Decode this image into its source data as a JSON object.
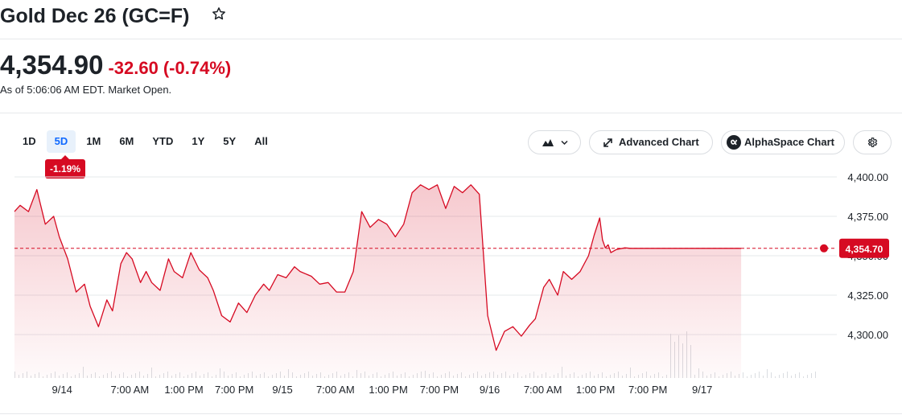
{
  "header": {
    "title": "Gold Dec 26 (GC=F)",
    "price": "4,354.90",
    "change": "-32.60",
    "change_pct": "(-0.74%)",
    "as_of": "As of 5:06:06 AM EDT. Market Open."
  },
  "toolbar": {
    "ranges": [
      "1D",
      "5D",
      "1M",
      "6M",
      "YTD",
      "1Y",
      "5Y",
      "All"
    ],
    "active_range": "5D",
    "period_change": "-1.19%",
    "advanced_chart": "Advanced Chart",
    "alphaspace_chart": "AlphaSpace Chart"
  },
  "colors": {
    "down": "#d60a22",
    "active_tab": "#0f69ff",
    "text": "#1d2228",
    "grid": "#e6e8eb"
  },
  "chart_data": {
    "type": "area",
    "ylim": [
      4280,
      4405
    ],
    "yticks": [
      4300,
      4325,
      4350,
      4375,
      4400
    ],
    "ytick_labels": [
      "4,300.00",
      "4,325.00",
      "4,350.00",
      "4,375.00",
      "4,400.00"
    ],
    "last_price": 4354.7,
    "last_price_label": "4,354.70",
    "x_labels": [
      {
        "label": "9/14",
        "pos": 0.17
      },
      {
        "label": "7:00 AM",
        "pos": 0.412
      },
      {
        "label": "1:00 PM",
        "pos": 0.605
      },
      {
        "label": "7:00 PM",
        "pos": 0.785
      },
      {
        "label": "9/15",
        "pos": 0.957
      },
      {
        "label": "7:00 AM",
        "pos": 1.146
      },
      {
        "label": "1:00 PM",
        "pos": 1.335
      },
      {
        "label": "7:00 PM",
        "pos": 1.517
      },
      {
        "label": "9/16",
        "pos": 1.697
      },
      {
        "label": "7:00 AM",
        "pos": 1.887
      },
      {
        "label": "1:00 PM",
        "pos": 2.075
      },
      {
        "label": "7:00 PM",
        "pos": 2.262
      },
      {
        "label": "9/17",
        "pos": 2.456
      }
    ],
    "xlim": [
      0,
      2.595
    ],
    "series": [
      {
        "x": [
          0,
          0.02,
          0.05,
          0.08,
          0.11,
          0.14,
          0.16,
          0.19,
          0.22,
          0.25,
          0.27,
          0.3,
          0.33,
          0.35,
          0.38,
          0.4,
          0.42,
          0.45,
          0.47,
          0.49,
          0.52,
          0.55,
          0.57,
          0.6,
          0.63,
          0.66,
          0.69,
          0.71,
          0.74,
          0.77,
          0.8,
          0.83,
          0.86,
          0.89,
          0.91,
          0.94,
          0.97,
          1.0,
          1.02,
          1.06,
          1.09,
          1.12,
          1.15,
          1.18,
          1.21,
          1.24,
          1.27,
          1.3,
          1.33,
          1.36,
          1.39,
          1.42,
          1.45,
          1.48,
          1.51,
          1.54,
          1.57,
          1.6,
          1.63,
          1.66,
          1.69,
          1.72,
          1.75,
          1.78,
          1.81,
          1.84,
          1.86,
          1.89,
          1.91,
          1.94,
          1.96,
          1.99,
          2.02,
          2.05,
          2.07,
          2.09,
          2.1,
          2.11,
          2.12,
          2.13,
          2.15,
          2.18,
          2.2,
          2.23,
          2.26,
          2.29,
          2.32,
          2.35,
          2.38,
          2.41,
          2.44,
          2.47,
          2.5,
          2.53,
          2.55,
          2.57,
          2.58,
          2.595
        ],
        "y": [
          4378,
          4382,
          4378,
          4392,
          4370,
          4375,
          4362,
          4348,
          4327,
          4332,
          4318,
          4305,
          4322,
          4315,
          4345,
          4352,
          4348,
          4333,
          4340,
          4333,
          4328,
          4348,
          4340,
          4336,
          4352,
          4341,
          4336,
          4328,
          4312,
          4308,
          4320,
          4314,
          4325,
          4332,
          4328,
          4338,
          4336,
          4343,
          4340,
          4337,
          4332,
          4333,
          4327,
          4327,
          4340,
          4378,
          4368,
          4373,
          4370,
          4362,
          4370,
          4390,
          4395,
          4392,
          4395,
          4380,
          4394,
          4390,
          4395,
          4389,
          4312,
          4290,
          4302,
          4305,
          4299,
          4306,
          4310,
          4330,
          4335,
          4325,
          4340,
          4335,
          4340,
          4350,
          4363,
          4374,
          4360,
          4355,
          4357,
          4352,
          4354,
          4355,
          4354.7,
          4354.7,
          4354.7,
          4354.7,
          4354.7,
          4354.7,
          4354.7,
          4354.7,
          4354.7,
          4354.7,
          4354.7,
          4354.7,
          4354.7,
          4354.7,
          4354.7,
          4354.7
        ]
      }
    ]
  }
}
